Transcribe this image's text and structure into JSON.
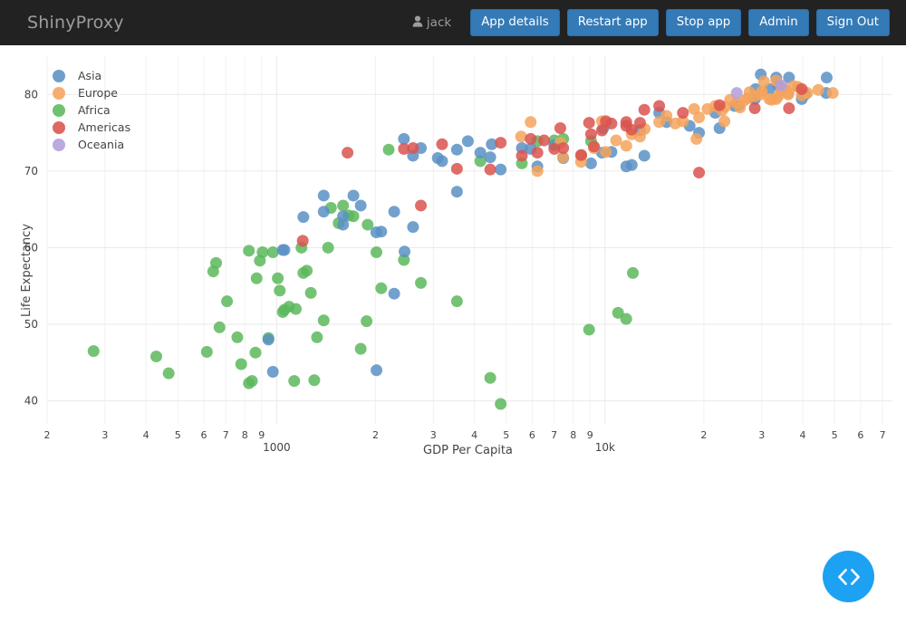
{
  "navbar": {
    "brand": "ShinyProxy",
    "user": "jack",
    "user_icon": "person-icon",
    "buttons": [
      {
        "label": "App details",
        "name": "app-details-button"
      },
      {
        "label": "Restart app",
        "name": "restart-app-button"
      },
      {
        "label": "Stop app",
        "name": "stop-app-button"
      },
      {
        "label": "Admin",
        "name": "admin-button"
      },
      {
        "label": "Sign Out",
        "name": "sign-out-button"
      }
    ]
  },
  "fab": {
    "icon": "code-brackets-icon",
    "color": "#1da1f2"
  },
  "colors": {
    "asia": "#5b91c4",
    "europe": "#f5a35c",
    "africa": "#5cb85c",
    "americas": "#d9534f",
    "oceania": "#b39ddb",
    "navbar_bg": "#222222",
    "button_bg": "#337ab7",
    "grid": "#eaeaea"
  },
  "chart_data": {
    "type": "scatter",
    "title": "",
    "xlabel": "GDP Per Capita",
    "ylabel": "Life Expectancy",
    "xscale": "log",
    "yscale": "linear",
    "xlim": [
      200,
      75000
    ],
    "ylim": [
      37,
      85
    ],
    "grid": true,
    "legend_position": "top-left",
    "ytick_labels": [
      "40",
      "50",
      "60",
      "70",
      "80"
    ],
    "ytick_values": [
      40,
      50,
      60,
      70,
      80
    ],
    "xtick_labels": [
      "2",
      "3",
      "4",
      "5",
      "6",
      "7",
      "8",
      "9",
      "1000",
      "2",
      "3",
      "4",
      "5",
      "6",
      "7",
      "8",
      "9",
      "10k",
      "2",
      "3",
      "4",
      "5",
      "6",
      "7"
    ],
    "xtick_values": [
      200,
      300,
      400,
      500,
      600,
      700,
      800,
      900,
      1000,
      2000,
      3000,
      4000,
      5000,
      6000,
      7000,
      8000,
      9000,
      10000,
      20000,
      30000,
      40000,
      50000,
      60000,
      70000
    ],
    "legend": [
      {
        "name": "Asia",
        "color": "#5b91c4"
      },
      {
        "name": "Europe",
        "color": "#f5a35c"
      },
      {
        "name": "Africa",
        "color": "#5cb85c"
      },
      {
        "name": "Americas",
        "color": "#d9534f"
      },
      {
        "name": "Oceania",
        "color": "#b39ddb"
      }
    ],
    "marker": {
      "size": 13,
      "opacity": 0.85,
      "shape": "circle"
    },
    "series": [
      {
        "name": "Asia",
        "color": "#5b91c4",
        "points": [
          [
            974,
            43.8
          ],
          [
            1391,
            64.7
          ],
          [
            2452,
            59.5
          ],
          [
            3540,
            72.8
          ],
          [
            4471,
            71.8
          ],
          [
            12779,
            75.3
          ],
          [
            29796,
            82.6
          ],
          [
            36319,
            82.2
          ],
          [
            47143,
            80.2
          ],
          [
            2082,
            62.1
          ],
          [
            1593,
            64.1
          ],
          [
            1044,
            59.7
          ],
          [
            3095,
            71.7
          ],
          [
            4172,
            72.4
          ],
          [
            2441,
            74.2
          ],
          [
            2749,
            73.0
          ],
          [
            3822,
            73.9
          ],
          [
            5937,
            72.9
          ],
          [
            7458,
            71.7
          ],
          [
            10461,
            72.5
          ],
          [
            12057,
            70.8
          ],
          [
            22316,
            75.6
          ],
          [
            25523,
            78.6
          ],
          [
            28569,
            79.4
          ],
          [
            31656,
            80.7
          ],
          [
            33207,
            82.2
          ],
          [
            39725,
            79.4
          ],
          [
            1713,
            66.8
          ],
          [
            2280,
            64.7
          ],
          [
            1593,
            63.0
          ],
          [
            1803,
            65.5
          ],
          [
            4811,
            70.2
          ],
          [
            7007,
            73.4
          ],
          [
            9065,
            71.0
          ],
          [
            11605,
            70.6
          ],
          [
            13172,
            72.0
          ],
          [
            15389,
            76.4
          ],
          [
            18100,
            75.9
          ],
          [
            21654,
            77.6
          ],
          [
            24821,
            78.5
          ],
          [
            2602,
            72.0
          ],
          [
            3190,
            71.3
          ],
          [
            4519,
            73.5
          ],
          [
            5581,
            73.0
          ],
          [
            6223,
            70.6
          ],
          [
            8458,
            72.0
          ],
          [
            9786,
            72.4
          ],
          [
            14619,
            77.6
          ],
          [
            3540,
            67.3
          ],
          [
            2011,
            62.0
          ],
          [
            1056,
            59.7
          ],
          [
            1206,
            64.0
          ],
          [
            1391,
            66.8
          ],
          [
            2602,
            62.7
          ],
          [
            944,
            48.0
          ],
          [
            2280,
            54.0
          ],
          [
            28718,
            80.7
          ],
          [
            47307,
            82.2
          ],
          [
            33693,
            81.2
          ],
          [
            40676,
            80.0
          ],
          [
            9875,
            75.6
          ],
          [
            19329,
            75.0
          ],
          [
            2014,
            44.0
          ]
        ]
      },
      {
        "name": "Europe",
        "color": "#f5a35c",
        "points": [
          [
            5937,
            76.4
          ],
          [
            9786,
            76.5
          ],
          [
            33693,
            79.8
          ],
          [
            36126,
            80.0
          ],
          [
            33203,
            79.4
          ],
          [
            35278,
            80.7
          ],
          [
            32170,
            79.3
          ],
          [
            36180,
            80.2
          ],
          [
            28569,
            79.8
          ],
          [
            31656,
            79.4
          ],
          [
            25768,
            78.3
          ],
          [
            22705,
            77.9
          ],
          [
            18678,
            78.1
          ],
          [
            15389,
            77.2
          ],
          [
            12779,
            74.5
          ],
          [
            10808,
            74.0
          ],
          [
            9253,
            73.0
          ],
          [
            8458,
            72.0
          ],
          [
            7446,
            71.8
          ],
          [
            14619,
            76.4
          ],
          [
            20509,
            78.1
          ],
          [
            24021,
            79.3
          ],
          [
            27538,
            80.3
          ],
          [
            30470,
            81.7
          ],
          [
            33207,
            81.8
          ],
          [
            37506,
            81.1
          ],
          [
            39725,
            79.9
          ],
          [
            41283,
            80.2
          ],
          [
            44614,
            80.6
          ],
          [
            49357,
            80.2
          ],
          [
            5551,
            74.5
          ],
          [
            7309,
            73.7
          ],
          [
            13206,
            75.5
          ],
          [
            17263,
            76.5
          ],
          [
            21654,
            78.5
          ],
          [
            26505,
            79.2
          ],
          [
            29796,
            80.0
          ],
          [
            34435,
            80.5
          ],
          [
            38668,
            81.0
          ],
          [
            19329,
            77.0
          ],
          [
            23235,
            78.4
          ],
          [
            16361,
            76.2
          ],
          [
            11605,
            73.3
          ],
          [
            10062,
            72.5
          ],
          [
            8447,
            71.2
          ],
          [
            6223,
            70.0
          ],
          [
            12057,
            74.8
          ],
          [
            27195,
            79.5
          ],
          [
            30035,
            80.4
          ],
          [
            23095,
            76.5
          ],
          [
            18982,
            74.2
          ],
          [
            25144,
            78.9
          ]
        ]
      },
      {
        "name": "Africa",
        "color": "#5cb85c",
        "points": [
          [
            277,
            46.5
          ],
          [
            430,
            45.8
          ],
          [
            469,
            43.6
          ],
          [
            613,
            46.4
          ],
          [
            641,
            56.9
          ],
          [
            654,
            58.0
          ],
          [
            706,
            53.0
          ],
          [
            759,
            48.3
          ],
          [
            780,
            44.8
          ],
          [
            823,
            42.3
          ],
          [
            841,
            42.6
          ],
          [
            862,
            46.3
          ],
          [
            869,
            56.0
          ],
          [
            889,
            58.3
          ],
          [
            906,
            59.4
          ],
          [
            944,
            48.2
          ],
          [
            974,
            59.4
          ],
          [
            1022,
            54.4
          ],
          [
            1044,
            51.6
          ],
          [
            1056,
            51.9
          ],
          [
            1091,
            52.3
          ],
          [
            1131,
            42.6
          ],
          [
            1190,
            60.0
          ],
          [
            1206,
            56.7
          ],
          [
            1271,
            54.1
          ],
          [
            1302,
            42.7
          ],
          [
            1327,
            48.3
          ],
          [
            1391,
            50.5
          ],
          [
            1463,
            65.2
          ],
          [
            1544,
            63.2
          ],
          [
            1593,
            65.5
          ],
          [
            1713,
            64.1
          ],
          [
            1803,
            46.8
          ],
          [
            1879,
            50.4
          ],
          [
            2082,
            54.7
          ],
          [
            2441,
            58.4
          ],
          [
            2749,
            55.4
          ],
          [
            3540,
            53.0
          ],
          [
            4471,
            43.0
          ],
          [
            4811,
            39.6
          ],
          [
            8941,
            49.3
          ],
          [
            10956,
            51.5
          ],
          [
            11599,
            50.7
          ],
          [
            12154,
            56.7
          ],
          [
            2013,
            59.4
          ],
          [
            1144,
            52.0
          ],
          [
            670,
            49.6
          ],
          [
            823,
            59.6
          ],
          [
            1008,
            56.0
          ],
          [
            1235,
            57.0
          ],
          [
            1434,
            60.0
          ],
          [
            1655,
            64.2
          ],
          [
            1893,
            63.0
          ],
          [
            2194,
            72.8
          ],
          [
            5581,
            71.0
          ],
          [
            6223,
            73.9
          ],
          [
            7007,
            74.0
          ],
          [
            7458,
            74.2
          ],
          [
            9065,
            73.9
          ],
          [
            4172,
            71.3
          ]
        ]
      },
      {
        "name": "Americas",
        "color": "#d9534f",
        "points": [
          [
            1201,
            60.9
          ],
          [
            2749,
            65.5
          ],
          [
            3540,
            70.3
          ],
          [
            4471,
            70.2
          ],
          [
            5581,
            72.0
          ],
          [
            6223,
            72.4
          ],
          [
            7007,
            72.9
          ],
          [
            7458,
            73.0
          ],
          [
            8458,
            72.1
          ],
          [
            9065,
            74.8
          ],
          [
            9786,
            75.3
          ],
          [
            10461,
            76.2
          ],
          [
            11605,
            76.4
          ],
          [
            12057,
            75.4
          ],
          [
            12779,
            76.3
          ],
          [
            13172,
            78.0
          ],
          [
            14619,
            78.5
          ],
          [
            17263,
            77.6
          ],
          [
            19329,
            69.8
          ],
          [
            22316,
            78.6
          ],
          [
            28569,
            78.2
          ],
          [
            36319,
            78.2
          ],
          [
            39725,
            80.7
          ],
          [
            2441,
            72.9
          ],
          [
            1644,
            72.4
          ],
          [
            2602,
            73.0
          ],
          [
            3190,
            73.5
          ],
          [
            4811,
            73.7
          ],
          [
            5937,
            74.2
          ],
          [
            8941,
            76.3
          ],
          [
            10062,
            76.5
          ],
          [
            11599,
            75.9
          ],
          [
            7309,
            75.6
          ],
          [
            6523,
            74.0
          ],
          [
            9253,
            73.2
          ]
        ]
      },
      {
        "name": "Oceania",
        "color": "#b39ddb",
        "points": [
          [
            25185,
            80.2
          ],
          [
            34435,
            81.2
          ]
        ]
      }
    ]
  }
}
